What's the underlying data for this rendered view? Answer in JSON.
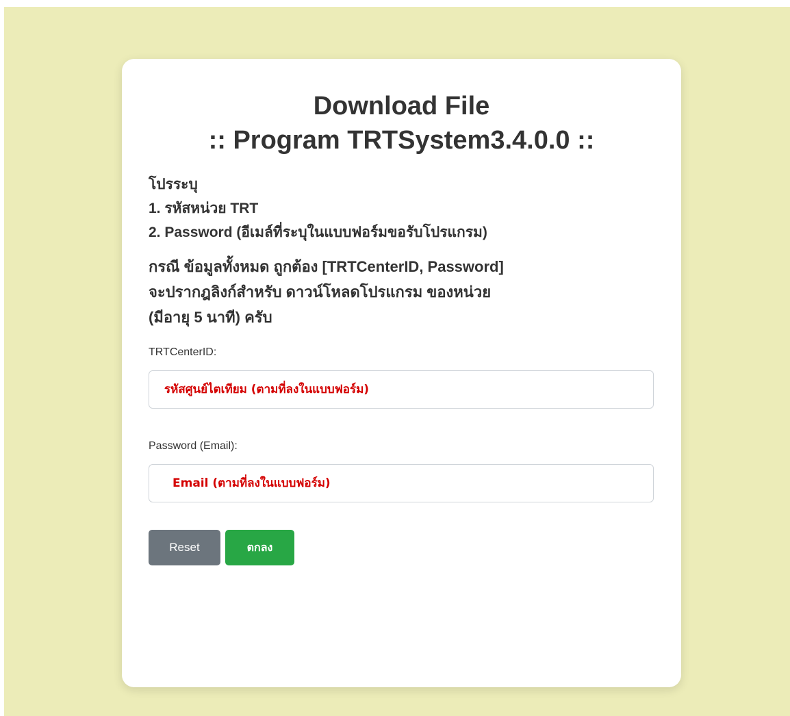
{
  "title": {
    "line1": "Download File",
    "line2": ":: Program TRTSystem3.4.0.0 ::"
  },
  "instructions": {
    "heading": "โปรระบุ",
    "item1": "1. รหัสหน่วย TRT",
    "item2": "2. Password (อีเมล์ที่ระบุในแบบฟอร์มขอรับโปรแกรม)"
  },
  "note": {
    "line1": "กรณี ข้อมูลทั้งหมด ถูกต้อง [TRTCenterID, Password]",
    "line2": "จะปรากฎลิงก์สำหรับ ดาวน์โหลดโปรแกรม ของหน่วย",
    "line3": "(มีอายุ 5 นาที) ครับ"
  },
  "form": {
    "center_id_label": "TRTCenterID:",
    "center_id_placeholder": "รหัสศูนย์ไตเทียม (ตามที่ลงในแบบฟอร์ม)",
    "password_label": "Password (Email):",
    "password_placeholder": "Email (ตามที่ลงในแบบฟอร์ม)"
  },
  "buttons": {
    "reset_label": "Reset",
    "submit_label": "ตกลง"
  },
  "colors": {
    "background": "#ececb8",
    "placeholder": "#d40000",
    "reset": "#6c757d",
    "submit": "#28a745"
  }
}
